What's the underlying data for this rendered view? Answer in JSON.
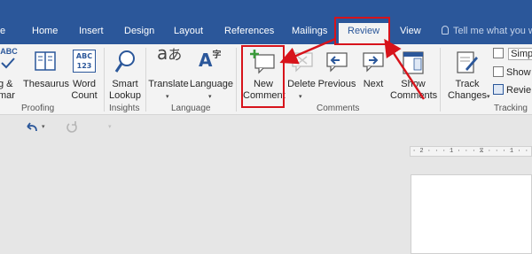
{
  "tabs": {
    "home": "Home",
    "insert": "Insert",
    "design": "Design",
    "layout": "Layout",
    "references": "References",
    "mailings": "Mailings",
    "review": "Review",
    "view": "View",
    "tell_me": "Tell me what you w",
    "partial_left": "e"
  },
  "ribbon": {
    "spelling_line1": "g &",
    "spelling_line2": "mar",
    "thesaurus": "Thesaurus",
    "word_count_icon_text": "ABC\n123",
    "word_count_line1": "Word",
    "word_count_line2": "Count",
    "abc_partial": "ABC",
    "smart_lookup_line1": "Smart",
    "smart_lookup_line2": "Lookup",
    "translate": "Translate",
    "language": "Language",
    "new_comment_line1": "New",
    "new_comment_line2": "Comment",
    "delete": "Delete",
    "previous": "Previous",
    "next": "Next",
    "show_comments_line1": "Show",
    "show_comments_line2": "Comments",
    "track_changes_line1": "Track",
    "track_changes_line2": "Changes",
    "simple_markup": "Simp",
    "show_markup": "Show",
    "reviewing_pane": "Revie"
  },
  "groups": {
    "proofing": "Proofing",
    "insights": "Insights",
    "language": "Language",
    "comments": "Comments",
    "tracking": "Tracking"
  },
  "ruler": {
    "text": "· 2 · · · 1 · · · ⧖ · · · 1 · ·"
  },
  "colors": {
    "accent": "#2b579a",
    "annotation_red": "#d7131b"
  }
}
